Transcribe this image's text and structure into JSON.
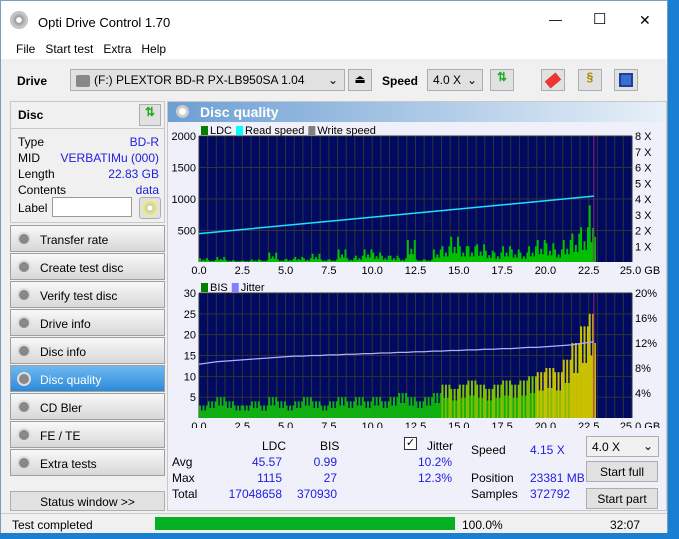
{
  "window": {
    "title": "Opti Drive Control 1.70",
    "minimize": "—",
    "maximize": "☐",
    "close": "✕"
  },
  "menu": [
    "File",
    "Start test",
    "Extra",
    "Help"
  ],
  "toolbar": {
    "drive_label": "Drive",
    "drive_value": "(F:)   PLEXTOR BD-R  PX-LB950SA 1.04",
    "speed_label": "Speed",
    "speed_value": "4.0 X"
  },
  "disc": {
    "header": "Disc",
    "rows": [
      {
        "k": "Type",
        "v": "BD-R"
      },
      {
        "k": "MID",
        "v": "VERBATIMu (000)"
      },
      {
        "k": "Length",
        "v": "22.83 GB"
      },
      {
        "k": "Contents",
        "v": "data"
      }
    ],
    "label_label": "Label",
    "label_value": ""
  },
  "sidebar": [
    "Transfer rate",
    "Create test disc",
    "Verify test disc",
    "Drive info",
    "Disc info",
    "Disc quality",
    "CD Bler",
    "FE / TE",
    "Extra tests"
  ],
  "active_item": "Disc quality",
  "status_window": "Status window >>",
  "panel_title": "Disc quality",
  "chart_data": [
    {
      "type": "bar",
      "legend": [
        "LDC",
        "Read speed",
        "Write speed"
      ],
      "legend_colors": [
        "#008000",
        "#00ffff",
        "#808080"
      ],
      "xlim": [
        0,
        25
      ],
      "xticks": [
        "0.0",
        "2.5",
        "5.0",
        "7.5",
        "10.0",
        "12.5",
        "15.0",
        "17.5",
        "20.0",
        "22.5",
        "25.0 GB"
      ],
      "ylim": [
        0,
        2000
      ],
      "yticks": [
        "500",
        "1000",
        "1500",
        "2000"
      ],
      "y2lim": [
        0,
        8
      ],
      "y2ticks": [
        "1 X",
        "2 X",
        "3 X",
        "4 X",
        "5 X",
        "6 X",
        "7 X",
        "8 X"
      ],
      "x": [
        0,
        0.5,
        1,
        1.5,
        2,
        2.5,
        3,
        3.5,
        4,
        4.5,
        5,
        5.5,
        6,
        6.5,
        7,
        7.5,
        8,
        8.5,
        9,
        9.5,
        10,
        10.5,
        11,
        11.5,
        12,
        12.5,
        13,
        13.5,
        14,
        14.5,
        15,
        15.5,
        16,
        16.5,
        17,
        17.5,
        18,
        18.5,
        19,
        19.5,
        20,
        20.5,
        21,
        21.5,
        22,
        22.5,
        22.8
      ],
      "ldc": [
        60,
        30,
        80,
        30,
        20,
        20,
        40,
        30,
        150,
        40,
        50,
        80,
        60,
        130,
        40,
        40,
        200,
        60,
        100,
        200,
        150,
        100,
        100,
        60,
        350,
        40,
        40,
        200,
        250,
        400,
        250,
        250,
        280,
        180,
        150,
        250,
        200,
        150,
        250,
        350,
        300,
        200,
        350,
        450,
        550,
        900,
        400
      ],
      "read_speed_x": [
        0,
        22.8
      ],
      "read_speed": [
        1.8,
        4.18
      ],
      "end_marker": 22.8
    },
    {
      "type": "bar",
      "legend": [
        "BIS",
        "Jitter"
      ],
      "legend_colors": [
        "#008000",
        "#8080ff"
      ],
      "xlim": [
        0,
        25
      ],
      "xticks": [
        "0.0",
        "2.5",
        "5.0",
        "7.5",
        "10.0",
        "12.5",
        "15.0",
        "17.5",
        "20.0",
        "22.5",
        "25.0 GB"
      ],
      "ylim": [
        0,
        30
      ],
      "yticks": [
        "5",
        "10",
        "15",
        "20",
        "25",
        "30"
      ],
      "y2lim": [
        0,
        20
      ],
      "y2ticks": [
        "4%",
        "8%",
        "12%",
        "16%",
        "20%"
      ],
      "bis": [
        3,
        4,
        5,
        4,
        3,
        3,
        4,
        3,
        5,
        4,
        3,
        4,
        5,
        4,
        3,
        4,
        5,
        4,
        5,
        4,
        5,
        4,
        5,
        6,
        5,
        4,
        5,
        6,
        8,
        7,
        8,
        9,
        8,
        7,
        8,
        9,
        8,
        9,
        10,
        11,
        12,
        11,
        14,
        18,
        22,
        25,
        18
      ],
      "jitter": [
        8.6,
        8.8,
        9.0,
        9.1,
        9.2,
        9.3,
        9.4,
        9.5,
        9.6,
        9.7,
        9.8,
        9.9,
        9.9,
        10.0,
        10.0,
        10.1,
        10.1,
        10.2,
        10.2,
        10.3,
        10.3,
        10.4,
        10.4,
        10.5,
        10.5,
        10.6,
        10.6,
        10.7,
        10.7,
        10.8,
        10.8,
        10.9,
        10.9,
        11.0,
        11.0,
        11.1,
        11.1,
        11.2,
        11.3,
        11.3,
        11.4,
        11.5,
        11.6,
        11.7,
        11.9,
        12.1,
        12.2
      ]
    }
  ],
  "stats": {
    "col_ldc": "LDC",
    "col_bis": "BIS",
    "jitter_label": "Jitter",
    "jitter_checked": true,
    "rows": [
      {
        "k": "Avg",
        "ldc": "45.57",
        "bis": "0.99",
        "jit": "10.2%"
      },
      {
        "k": "Max",
        "ldc": "1115",
        "bis": "27",
        "jit": "12.3%"
      },
      {
        "k": "Total",
        "ldc": "17048658",
        "bis": "370930",
        "jit": ""
      }
    ],
    "speed_label": "Speed",
    "speed_value": "4.15 X",
    "position_label": "Position",
    "position_value": "23381 MB",
    "samples_label": "Samples",
    "samples_value": "372792",
    "speed_select": "4.0 X",
    "start_full": "Start full",
    "start_part": "Start part"
  },
  "status": {
    "text": "Test completed",
    "progress": 100,
    "progress_text": "100.0%",
    "time": "32:07"
  }
}
